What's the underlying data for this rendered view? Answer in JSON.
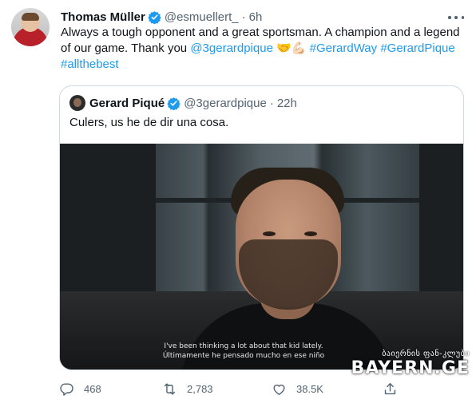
{
  "tweet": {
    "author_name": "Thomas Müller",
    "handle": "@esmuellert_",
    "separator": "·",
    "time": "6h",
    "text_main": "Always a tough opponent and a great sportsman. A champion and a legend of our game. Thank you ",
    "mention": "@3gerardpique",
    "emojis": "🤝💪🏻",
    "hashtag1": "#GerardWay",
    "hashtag2": "#GerardPique",
    "hashtag3": "#allthebest",
    "icons": [
      "verified-badge-icon",
      "more-options-icon"
    ]
  },
  "quote": {
    "author_name": "Gerard Piqué",
    "handle": "@3gerardpique",
    "separator": "·",
    "time": "22h",
    "text": "Culers, us he de dir una cosa.",
    "video": {
      "subtitle_en": "I've been thinking a lot about that kid lately.",
      "subtitle_es": "Últimamente he pensado mucho en ese niño"
    }
  },
  "watermark": {
    "top": "ბაიერნის ფან-კლუბი",
    "main": "BAYERN.GE"
  },
  "actions": {
    "reply_count": "468",
    "retweet_count": "2,783",
    "like_count": "38.5K",
    "icons": [
      "reply-icon",
      "retweet-icon",
      "like-icon",
      "share-icon"
    ]
  },
  "colors": {
    "link": "#1d9bf0",
    "text": "#0f1419",
    "secondary": "#536471",
    "border": "#cfd9de"
  }
}
